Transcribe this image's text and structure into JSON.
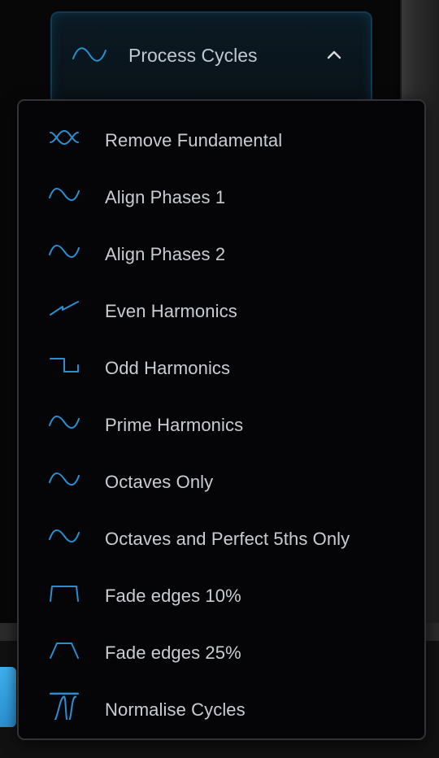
{
  "header": {
    "label": "Process Cycles",
    "icon": "sine-wave-icon",
    "chevron": "chevron-up-icon"
  },
  "menu": {
    "items": [
      {
        "label": "Remove Fundamental",
        "icon": "crossed-sine-icon"
      },
      {
        "label": "Align Phases 1",
        "icon": "sine-wave-icon"
      },
      {
        "label": "Align Phases 2",
        "icon": "sine-wave-icon"
      },
      {
        "label": "Even Harmonics",
        "icon": "sawtooth-wave-icon"
      },
      {
        "label": "Odd Harmonics",
        "icon": "square-wave-icon"
      },
      {
        "label": "Prime Harmonics",
        "icon": "sine-wave-icon"
      },
      {
        "label": "Octaves Only",
        "icon": "sine-wave-icon"
      },
      {
        "label": "Octaves and Perfect 5ths Only",
        "icon": "sine-wave-icon"
      },
      {
        "label": "Fade edges 10%",
        "icon": "fade-short-icon"
      },
      {
        "label": "Fade edges 25%",
        "icon": "fade-long-icon"
      },
      {
        "label": "Normalise Cycles",
        "icon": "normalise-icon"
      }
    ]
  },
  "colors": {
    "accent": "#2a8fd0",
    "text": "#c9cdd1",
    "menu_bg": "#050507",
    "menu_border": "#333333"
  }
}
